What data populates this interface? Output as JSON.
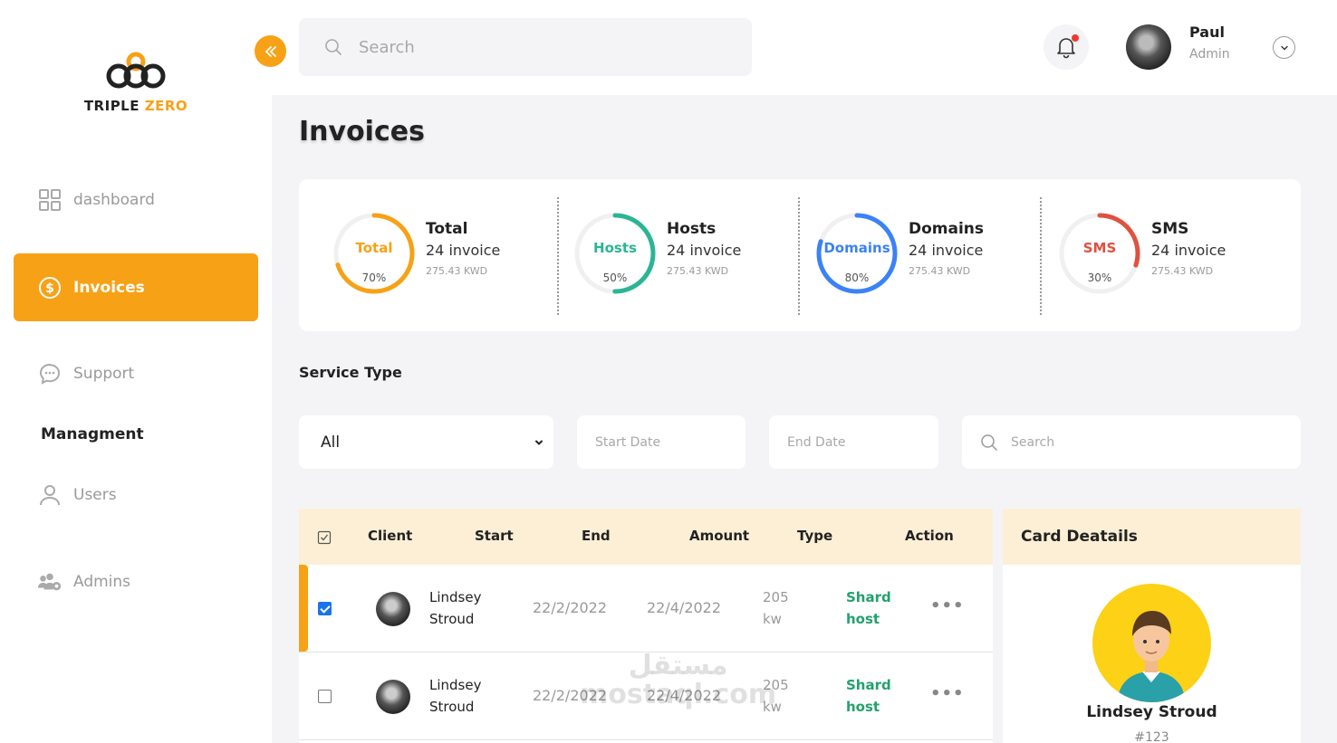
{
  "brand": {
    "name_part1": "TRIPLE ",
    "name_part2": "ZERO"
  },
  "sidebar": {
    "items": [
      {
        "label": "dashboard"
      },
      {
        "label": "Invoices"
      },
      {
        "label": "Support"
      },
      {
        "label": "Users"
      },
      {
        "label": "Admins"
      }
    ],
    "section_title": "Managment"
  },
  "topbar": {
    "search_placeholder": "Search",
    "user": {
      "name": "Paul",
      "role": "Admin"
    }
  },
  "page": {
    "title": "Invoices"
  },
  "stats": [
    {
      "ring_label": "Total",
      "percent": 70,
      "percent_text": "70%",
      "title": "Total",
      "count": "24 invoice",
      "amount": "275.43 KWD",
      "color": "#f7a116"
    },
    {
      "ring_label": "Hosts",
      "percent": 50,
      "percent_text": "50%",
      "title": "Hosts",
      "count": "24 invoice",
      "amount": "275.43 KWD",
      "color": "#2bb594"
    },
    {
      "ring_label": "Domains",
      "percent": 80,
      "percent_text": "80%",
      "title": "Domains",
      "count": "24 invoice",
      "amount": "275.43 KWD",
      "color": "#3b82f6"
    },
    {
      "ring_label": "SMS",
      "percent": 30,
      "percent_text": "30%",
      "title": "SMS",
      "count": "24 invoice",
      "amount": "275.43 KWD",
      "color": "#e0513f"
    }
  ],
  "filters": {
    "section_label": "Service Type",
    "service_type_value": "All",
    "start_date_placeholder": "Start Date",
    "end_date_placeholder": "End Date",
    "search_placeholder": "Search"
  },
  "table": {
    "headers": {
      "client": "Client",
      "start": "Start",
      "end": "End",
      "amount": "Amount",
      "type": "Type",
      "action": "Action"
    },
    "rows": [
      {
        "client_first": "Lindsey",
        "client_last": "Stroud",
        "start": "22/2/2022",
        "end": "22/4/2022",
        "amount_value": "205",
        "amount_unit": "kw",
        "type_line1": "Shard",
        "type_line2": "host",
        "action": "•••",
        "checked": true
      },
      {
        "client_first": "Lindsey",
        "client_last": "Stroud",
        "start": "22/2/2022",
        "end": "22/4/2022",
        "amount_value": "205",
        "amount_unit": "kw",
        "type_line1": "Shard",
        "type_line2": "host",
        "action": "•••",
        "checked": false
      }
    ]
  },
  "card_details": {
    "title": "Card Deatails",
    "name": "Lindsey Stroud",
    "id": "#123"
  },
  "watermark": {
    "line1": "مستقل",
    "line2": "mostaql.com"
  }
}
